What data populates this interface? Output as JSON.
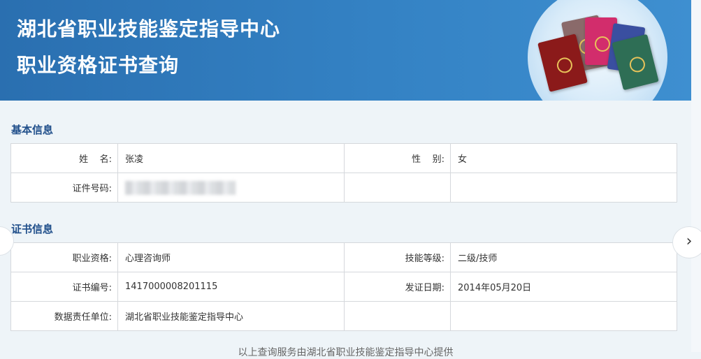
{
  "header": {
    "org_title": "湖北省职业技能鉴定指导中心",
    "page_title": "职业资格证书查询"
  },
  "basic_info": {
    "section_title": "基本信息",
    "name_label": "姓    名:",
    "name_value": "张凌",
    "gender_label": "性    别:",
    "gender_value": "女",
    "id_label": "证件号码:",
    "id_value_redacted": true
  },
  "cert_info": {
    "section_title": "证书信息",
    "qualification_label": "职业资格:",
    "qualification_value": "心理咨询师",
    "skill_level_label": "技能等级:",
    "skill_level_value": "二级/技师",
    "cert_no_label": "证书编号:",
    "cert_no_value": "1417000008201115",
    "issue_date_label": "发证日期:",
    "issue_date_value": "2014年05月20日",
    "responsible_unit_label": "数据责任单位:",
    "responsible_unit_value": "湖北省职业技能鉴定指导中心"
  },
  "footer": {
    "text": "以上查询服务由湖北省职业技能鉴定指导中心提供"
  },
  "nav": {
    "next_icon": "chevron-right-icon",
    "prev_icon": "chevron-left-icon"
  },
  "colors": {
    "header_bg": "#2f7bc0",
    "section_title": "#1f4e8a",
    "book_red": "#8b1a1a",
    "book_brown": "#8a6a6a",
    "book_pink": "#d22d6c",
    "book_blue": "#3a4fa0",
    "book_green": "#2e6e55"
  }
}
